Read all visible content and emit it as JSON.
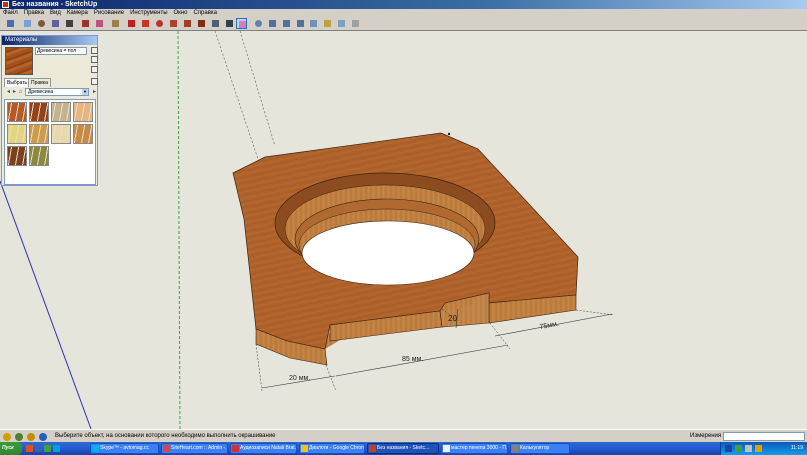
{
  "window": {
    "title": "Без названия - SketchUp"
  },
  "menu": [
    "Файл",
    "Правка",
    "Вид",
    "Камера",
    "Рисование",
    "Инструменты",
    "Окно",
    "Справка"
  ],
  "toolbar": [
    {
      "icon": "select-arrow-icon",
      "color": "#4a6fb0"
    },
    {
      "icon": "rectangle-icon",
      "color": "#7aa0d8"
    },
    {
      "icon": "circle-icon",
      "color": "#7a5a3a"
    },
    {
      "icon": "polygon-icon",
      "color": "#6060a0"
    },
    {
      "icon": "pencil-line-icon",
      "color": "#404040"
    },
    {
      "icon": "arc-icon",
      "color": "#a03030"
    },
    {
      "icon": "eraser-icon",
      "color": "#c05080"
    },
    {
      "icon": "tape-measure-icon",
      "color": "#a08040"
    },
    {
      "icon": "push-pull-icon",
      "color": "#c02020"
    },
    {
      "icon": "move-icon",
      "color": "#d03020"
    },
    {
      "icon": "rotate-icon",
      "color": "#c03030"
    },
    {
      "icon": "follow-me-icon",
      "color": "#b04030"
    },
    {
      "icon": "scale-icon",
      "color": "#a04020"
    },
    {
      "icon": "offset-icon",
      "color": "#803010"
    },
    {
      "icon": "dimension-icon",
      "color": "#506070"
    },
    {
      "icon": "walk-icon",
      "color": "#304050"
    },
    {
      "icon": "paint-bucket-icon",
      "color": "#d080c0"
    },
    {
      "icon": "orbit-icon",
      "color": "#6080b0"
    },
    {
      "icon": "zoom-icon",
      "color": "#5070a0"
    },
    {
      "icon": "zoom-window-icon",
      "color": "#5070a0"
    },
    {
      "icon": "zoom-extents-icon",
      "color": "#5070a0"
    },
    {
      "icon": "warehouse-icon",
      "color": "#7090c0"
    },
    {
      "icon": "share-model-icon",
      "color": "#c0a040"
    },
    {
      "icon": "components-icon",
      "color": "#80a0c0"
    },
    {
      "icon": "extension-icon",
      "color": "#a0a0a0"
    }
  ],
  "materials_panel": {
    "title": "Материалы",
    "material_name": "Древесина = пол",
    "tabs": [
      "Выбрать",
      "Правка"
    ],
    "active_tab": 0,
    "collection": "Древесина",
    "swatches": [
      "#b55a22",
      "#9a4015",
      "#c3b48b",
      "#e8b67c",
      "#e5d47a",
      "#d19a44",
      "#e9d8a8",
      "#c98a40",
      "#7e3f1a",
      "#8b8a3c"
    ]
  },
  "model": {
    "top_color": "#b0622b",
    "side_color": "#c08040",
    "dimensions": [
      {
        "label": "20 мм."
      },
      {
        "label": "85 мм."
      },
      {
        "label": "20"
      },
      {
        "label": "75мм."
      }
    ]
  },
  "status": {
    "text": "Выберите объект, на основании которого необходимо выполнить окрашивание",
    "measure_label": "Измерения",
    "icons": [
      {
        "icon": "info-icon",
        "color": "#d0a000"
      },
      {
        "icon": "geo-location-icon",
        "color": "#508030"
      },
      {
        "icon": "credits-icon",
        "color": "#c09000"
      },
      {
        "icon": "help-icon",
        "color": "#2060c0"
      }
    ]
  },
  "taskbar": {
    "start": "Пуск",
    "quicklaunch": [
      {
        "icon": "browser-icon",
        "color": "#e05020"
      },
      {
        "icon": "desktop-icon",
        "color": "#3060c0"
      },
      {
        "icon": "media-icon",
        "color": "#40a040"
      },
      {
        "icon": "skype-icon",
        "color": "#00a0e0"
      }
    ],
    "tasks": [
      {
        "label": "Skype™ - avtomag.cc",
        "icon": "skype-icon",
        "color": "#00aff0",
        "active": false
      },
      {
        "label": "SiteHeart.com :: Admin -...",
        "icon": "siteheart-icon",
        "color": "#e04040",
        "active": false
      },
      {
        "label": "Аудиозаписи Natali Brat...",
        "icon": "opera-icon",
        "color": "#d03030",
        "active": false
      },
      {
        "label": "Диалоги - Google Chrome",
        "icon": "chrome-icon",
        "color": "#f0c020",
        "active": false
      },
      {
        "label": "Без названия - Sketc...",
        "icon": "sketchup-icon",
        "color": "#c04020",
        "active": true
      },
      {
        "label": "мастер пенепа 3000 - П...",
        "icon": "document-icon",
        "color": "#f0f0f0",
        "active": false
      },
      {
        "label": "Калькулятор",
        "icon": "calculator-icon",
        "color": "#808080",
        "active": false
      }
    ],
    "tray_icons": [
      {
        "icon": "language-icon",
        "color": "#2040a0"
      },
      {
        "icon": "network-icon",
        "color": "#40a040"
      },
      {
        "icon": "volume-icon",
        "color": "#c0c0c0"
      },
      {
        "icon": "shield-icon",
        "color": "#e0a000"
      }
    ],
    "clock": "11:19"
  }
}
